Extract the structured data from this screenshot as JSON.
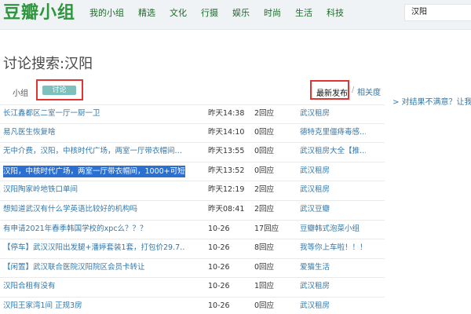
{
  "header": {
    "logo": "豆瓣小组",
    "nav": [
      "我的小组",
      "精选",
      "文化",
      "行摄",
      "娱乐",
      "时尚",
      "生活",
      "科技"
    ],
    "search_value": "汉阳"
  },
  "page_title": "讨论搜索:汉阳",
  "filters": {
    "tab_group": "小组",
    "tab_discussion": "讨论",
    "sort_latest": "最新发布",
    "sort_separator": "/",
    "sort_relevance": "相关度"
  },
  "side_link": "> 对结果不满意？让我们",
  "results": [
    {
      "title": "长江鑫都区二室一厅一厨一卫",
      "time": "昨天14:38",
      "replies": "2回应",
      "group": "武汉租房"
    },
    {
      "title": "易凡医生恢复啥",
      "time": "昨天14:10",
      "replies": "0回应",
      "group": "德特克里僵痔毒感…"
    },
    {
      "title": "无中介费，汉阳，中核时代广场，两室一厅带衣帽间…",
      "time": "昨天13:55",
      "replies": "0回应",
      "group": "武汉租房大全【推…"
    },
    {
      "title": "汉阳，中核时代广场，两室一厅带衣帽间，1000+可短…",
      "time": "昨天13:52",
      "replies": "0回应",
      "group": "武汉租房"
    },
    {
      "title": "汉阳陶家岭地铁口单间",
      "time": "昨天12:19",
      "replies": "2回应",
      "group": "武汉租房"
    },
    {
      "title": "想知道武汉有什么学英语比较好的机构吗",
      "time": "昨天08:41",
      "replies": "2回应",
      "group": "武汉豆瓣"
    },
    {
      "title": "有申请2021年春季韩国学校的xpc么？？？",
      "time": "10-26",
      "replies": "17回应",
      "group": "豆瓣韩式泡菜小组"
    },
    {
      "title": "【停车】武汉汉阳出发腿+潘婷套装1套，打包价29.7…",
      "time": "10-26",
      "replies": "8回应",
      "group": "我等你上车啦！！！"
    },
    {
      "title": "【闲置】武汉联合医院汉阳院区会员卡转让",
      "time": "10-26",
      "replies": "0回应",
      "group": "爱猫生活"
    },
    {
      "title": "汉阳合租有没有",
      "time": "10-26",
      "replies": "1回应",
      "group": "武汉租房"
    },
    {
      "title": "汉阳王家湾1间 正规3房",
      "time": "10-26",
      "replies": "0回应",
      "group": "武汉租房"
    }
  ],
  "selected_row_index": 3,
  "colors": {
    "logo": "#2e963d",
    "nav_text": "#1b6b2a",
    "link": "#3377aa",
    "active_tab": "#7dc0bd",
    "highlight_box": "#e23434",
    "selection": "#2b6fd0"
  }
}
